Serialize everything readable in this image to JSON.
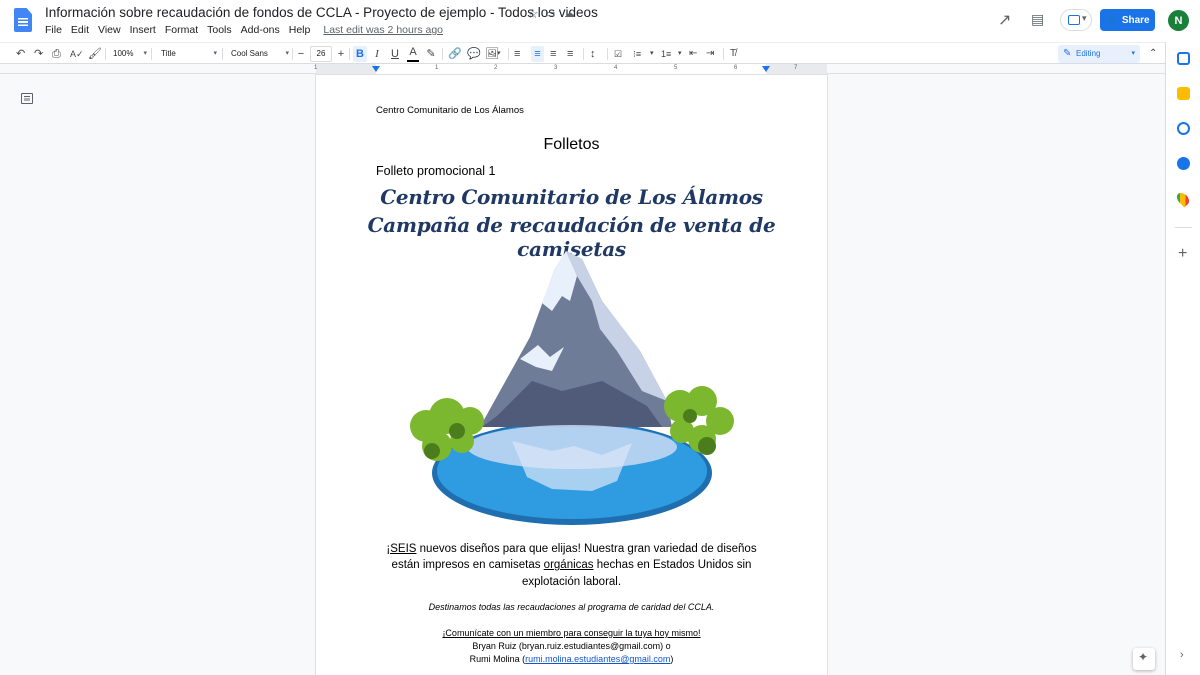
{
  "header": {
    "doc_title": "Información sobre recaudación de fondos de CCLA - Proyecto de ejemplo - Todos los videos",
    "last_edit": "Last edit was 2 hours ago",
    "share_label": "Share",
    "avatar_letter": "N",
    "menu": [
      "File",
      "Edit",
      "View",
      "Insert",
      "Format",
      "Tools",
      "Add-ons",
      "Help"
    ]
  },
  "toolbar": {
    "zoom": "100%",
    "style": "Title",
    "font": "Cool Sans",
    "font_size": "26",
    "mode": "Editing"
  },
  "ruler": {
    "numbers": [
      "1",
      "1",
      "2",
      "3",
      "4",
      "5",
      "6",
      "7"
    ]
  },
  "document": {
    "header_text": "Centro Comunitario de Los Álamos",
    "heading": "Folletos",
    "subheading": "Folleto promocional 1",
    "script_title_1": "Centro Comunitario de Los Álamos",
    "script_title_2": "Campaña de recaudación de venta de camisetas",
    "body_seis": "¡SEIS",
    "body_part_1": " nuevos diseños para que elijas! Nuestra gran variedad de diseños están impresos en camisetas ",
    "body_organicas": "orgánicas",
    "body_part_2": " hechas en Estados Unidos sin explotación laboral.",
    "italic_line": "Destinamos todas las recaudaciones al programa de caridad del CCLA.",
    "cta_line": "¡Comunícate con un miembro para conseguir la tuya hoy mismo!",
    "contact_1": "Bryan Ruiz (bryan.ruiz.estudiantes@gmail.com) o",
    "contact_2_prefix": "Rumi Molina (",
    "contact_2_link": "rumi.molina.estudiantes@gmail.com",
    "contact_2_suffix": ")"
  },
  "colors": {
    "accent": "#1a73e8",
    "script_title": "#1f3864",
    "lake": "#2f9be0",
    "lake_rim": "#1f6fb0",
    "mountain": "#6f7c98",
    "snow": "#e8f0fb",
    "trees": "#7cb82f"
  }
}
